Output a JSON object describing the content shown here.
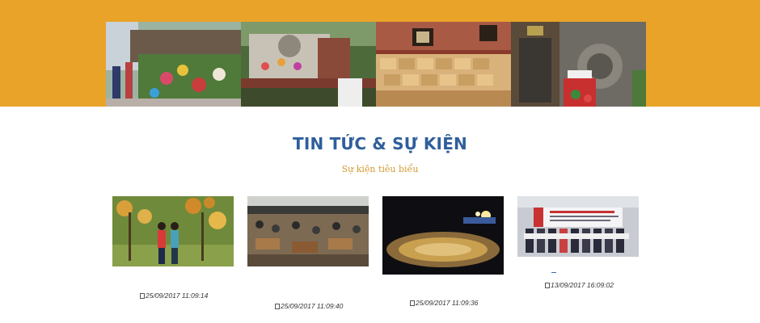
{
  "banner": {
    "photos": [
      {
        "icon": "flower-market-photo"
      },
      {
        "icon": "memorial-statue-photo"
      },
      {
        "icon": "rice-sacks-museum-photo"
      },
      {
        "icon": "stone-relief-photo"
      }
    ],
    "band_color": "#e9a329"
  },
  "news": {
    "title": "TIN TỨC & SỰ KIỆN",
    "subtitle": "Sự kiện tiêu biểu",
    "items": [
      {
        "date": "25/09/2017 11:09:14",
        "icon": "orchard-couple-photo"
      },
      {
        "date": "25/09/2017 11:09:40",
        "icon": "livestock-market-photo"
      },
      {
        "date": "25/09/2017 11:09:36",
        "icon": "night-festival-dance-photo"
      },
      {
        "date": "13/09/2017 16:09:02",
        "icon": "tourism-award-ceremony-photo"
      }
    ]
  },
  "colors": {
    "title": "#2f5f9b",
    "subtitle": "#d39a33"
  }
}
